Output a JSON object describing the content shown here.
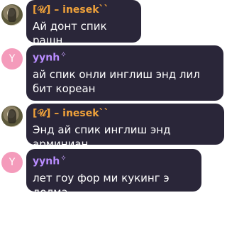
{
  "messages": [
    {
      "author": "[𝒰] – inesek``",
      "text": "Ай донт спик рашн",
      "avatar": "photo"
    },
    {
      "author": "yynh",
      "badge": "✧",
      "text": "ай спик онли инглиш энд лил бит кореан",
      "avatar_letter": "Y"
    },
    {
      "author": "[𝒰] – inesek``",
      "text": "Энд ай спик инглиш энд арминиан",
      "avatar": "photo"
    },
    {
      "author": "yynh",
      "badge": "✧",
      "text": "лет гоу фор ми кукинг э долма",
      "avatar_letter": "Y"
    }
  ],
  "colors": {
    "bubble": "#2a2639",
    "name_orange": "#f0a23a",
    "name_purple": "#b98cff",
    "avatar_pink": "#f49bbb"
  }
}
